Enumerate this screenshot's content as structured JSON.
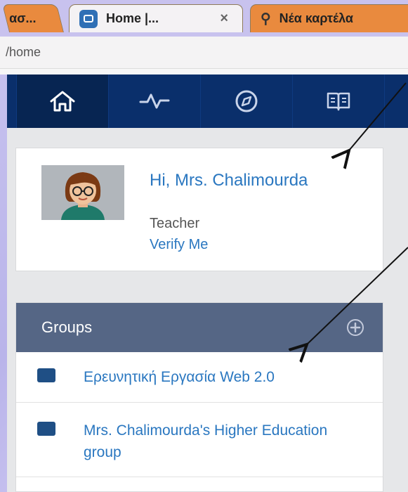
{
  "browser": {
    "tabs": [
      {
        "label": "ασ..."
      },
      {
        "label": "Home |...",
        "close": "×"
      },
      {
        "label": "Νέα καρτέλα"
      }
    ],
    "url": "/home"
  },
  "nav": {
    "items": [
      {
        "icon": "home-icon"
      },
      {
        "icon": "activity-icon"
      },
      {
        "icon": "compass-icon"
      },
      {
        "icon": "book-icon"
      }
    ]
  },
  "profile": {
    "greeting": "Hi, Mrs. Chalimourda",
    "role": "Teacher",
    "verify": "Verify Me"
  },
  "groups": {
    "title": "Groups",
    "items": [
      {
        "label": "Ερευνητική Εργασία Web 2.0"
      },
      {
        "label": "Mrs. Chalimourda's Higher Education group"
      }
    ]
  },
  "colors": {
    "navbar": "#0a2f6b",
    "groups_header": "#556685",
    "link": "#2a77c0",
    "tab_orange": "#e98a3e"
  }
}
